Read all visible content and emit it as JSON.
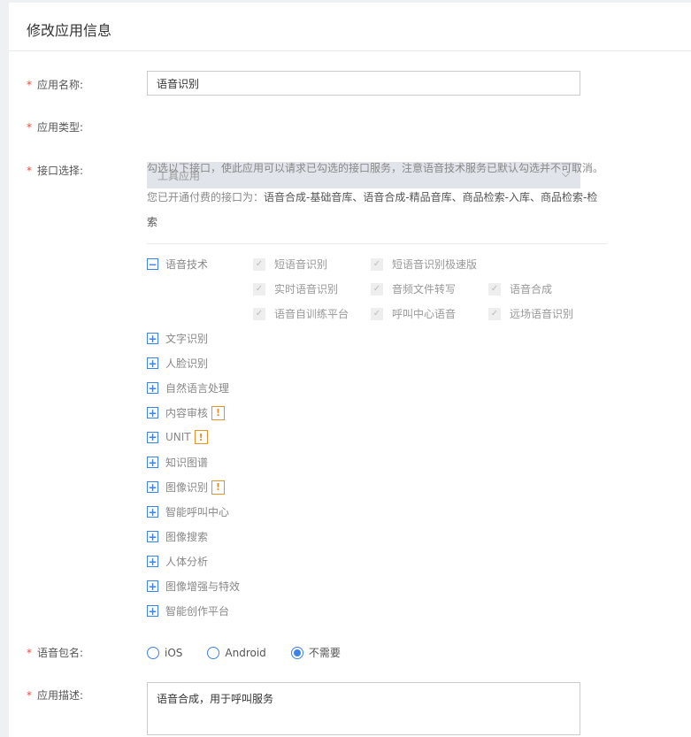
{
  "title": "修改应用信息",
  "fields": {
    "name": {
      "label": "应用名称:",
      "value": "语音识别"
    },
    "type": {
      "label": "应用类型:",
      "value": "工具应用"
    },
    "api": {
      "label": "接口选择:",
      "hint": "勾选以下接口，使此应用可以请求已勾选的接口服务，注意语音技术服务已默认勾选并不可取消。",
      "paid_prefix": "您已开通付费的接口为：",
      "paid_list": "语音合成-基础音库、语音合成-精品音库、商品检索-入库、商品检索-检索"
    },
    "package": {
      "label": "语音包名:",
      "options": [
        "iOS",
        "Android",
        "不需要"
      ],
      "selected": "不需要"
    },
    "desc": {
      "label": "应用描述:",
      "value": "语音合成，用于呼叫服务"
    }
  },
  "tree": {
    "expanded": {
      "label": "语音技术",
      "items": [
        "短语音识别",
        "短语音识别极速版",
        "实时语音识别",
        "音频文件转写",
        "语音合成",
        "语音自训练平台",
        "呼叫中心语音",
        "远场语音识别"
      ]
    },
    "collapsed": [
      {
        "label": "文字识别",
        "warn": false
      },
      {
        "label": "人脸识别",
        "warn": false
      },
      {
        "label": "自然语言处理",
        "warn": false
      },
      {
        "label": "内容审核",
        "warn": true
      },
      {
        "label": "UNIT",
        "warn": true
      },
      {
        "label": "知识图谱",
        "warn": false
      },
      {
        "label": "图像识别",
        "warn": true
      },
      {
        "label": "智能呼叫中心",
        "warn": false
      },
      {
        "label": "图像搜索",
        "warn": false
      },
      {
        "label": "人体分析",
        "warn": false
      },
      {
        "label": "图像增强与特效",
        "warn": false
      },
      {
        "label": "智能创作平台",
        "warn": false
      }
    ],
    "warn_symbol": "!"
  }
}
